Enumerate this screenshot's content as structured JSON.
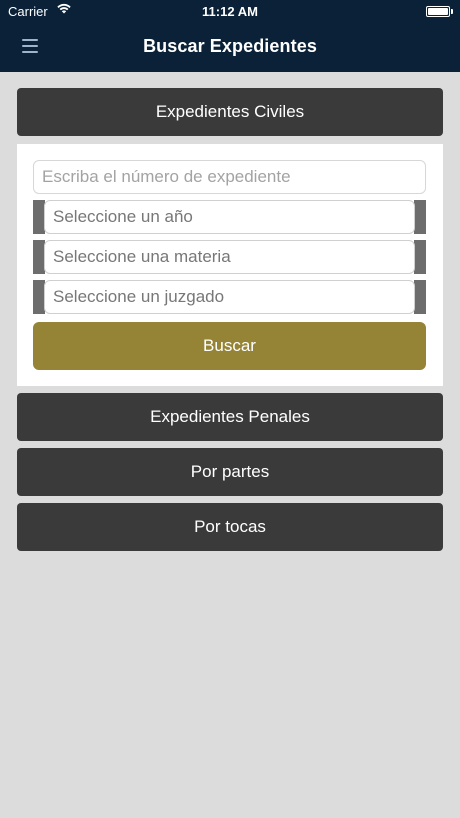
{
  "status_bar": {
    "carrier": "Carrier",
    "time": "11:12 AM"
  },
  "nav": {
    "title": "Buscar Expedientes",
    "menu_icon": "hamburger-menu-icon"
  },
  "sections": {
    "civiles_label": "Expedientes Civiles",
    "penales_label": "Expedientes Penales",
    "partes_label": "Por partes",
    "tocas_label": "Por tocas"
  },
  "form": {
    "expediente_placeholder": "Escriba el número de expediente",
    "year_select": "Seleccione un año",
    "materia_select": "Seleccione una materia",
    "juzgado_select": "Seleccione un juzgado",
    "buscar_label": "Buscar"
  },
  "colors": {
    "nav_background": "#0a2138",
    "section_button": "#3a3a3a",
    "buscar_button": "#958435",
    "page_background": "#dcdcdc"
  }
}
